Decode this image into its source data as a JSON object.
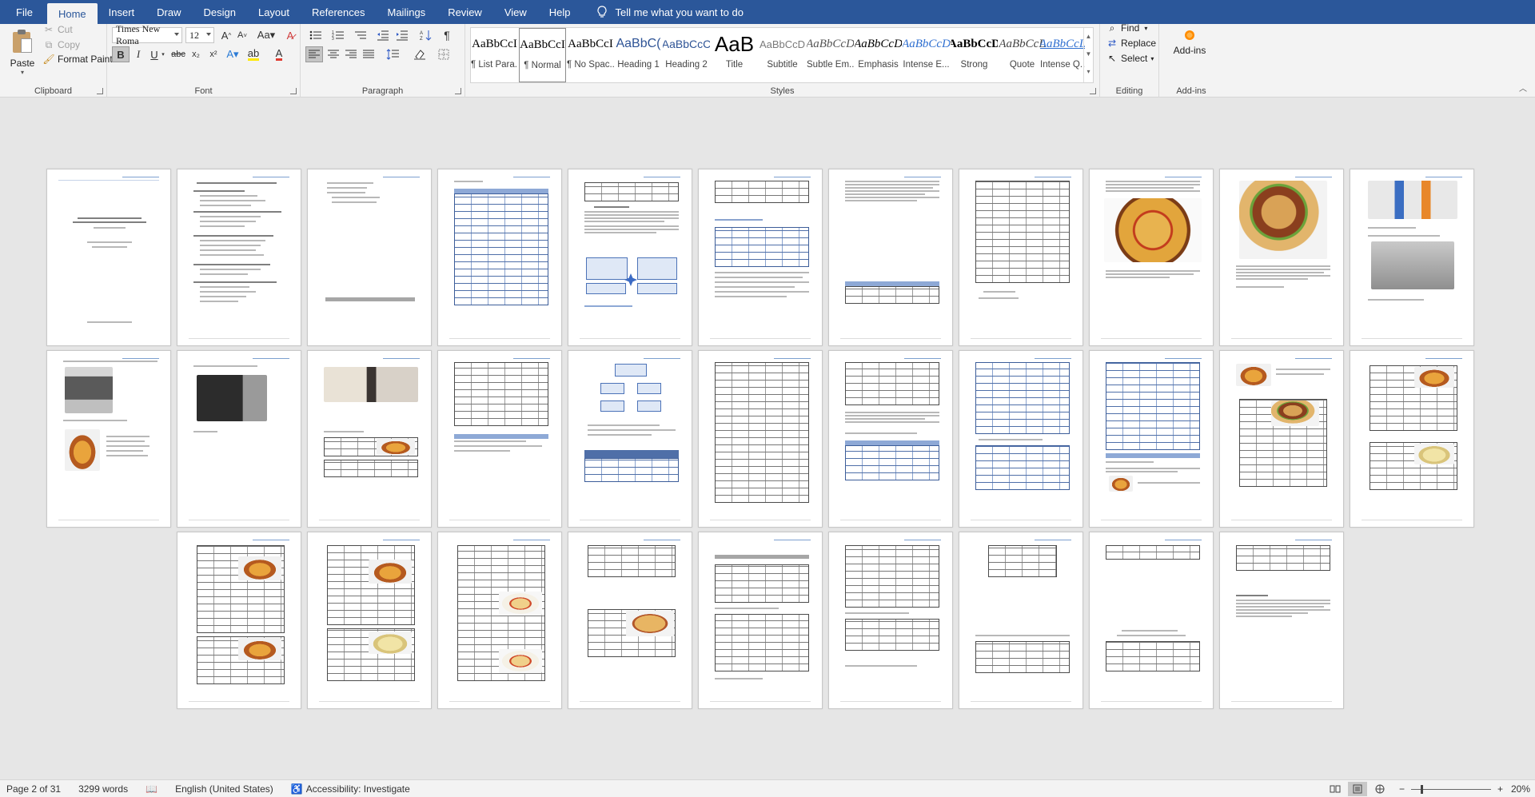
{
  "tabs": [
    "File",
    "Home",
    "Insert",
    "Draw",
    "Design",
    "Layout",
    "References",
    "Mailings",
    "Review",
    "View",
    "Help"
  ],
  "active_tab": "Home",
  "tell_me": "Tell me what you want to do",
  "clipboard": {
    "paste": "Paste",
    "cut": "Cut",
    "copy": "Copy",
    "format_painter": "Format Painter",
    "label": "Clipboard"
  },
  "font": {
    "name": "Times New Roma",
    "size": "12",
    "label": "Font",
    "buttons": [
      "B",
      "I",
      "U",
      "abc",
      "x₂",
      "x²"
    ]
  },
  "paragraph": {
    "label": "Paragraph"
  },
  "styles": {
    "label": "Styles",
    "items": [
      {
        "sample": "AaBbCcI",
        "name": "¶ List Para..."
      },
      {
        "sample": "AaBbCcI",
        "name": "¶ Normal"
      },
      {
        "sample": "AaBbCcI",
        "name": "¶ No Spac..."
      },
      {
        "sample": "AaBbC(",
        "name": "Heading 1"
      },
      {
        "sample": "AaBbCcC",
        "name": "Heading 2"
      },
      {
        "sample": "AaB",
        "name": "Title"
      },
      {
        "sample": "AaBbCcD",
        "name": "Subtitle"
      },
      {
        "sample": "AaBbCcD",
        "name": "Subtle Em..."
      },
      {
        "sample": "AaBbCcD",
        "name": "Emphasis"
      },
      {
        "sample": "AaBbCcD",
        "name": "Intense E..."
      },
      {
        "sample": "AaBbCcD",
        "name": "Strong"
      },
      {
        "sample": "AaBbCcL",
        "name": "Quote"
      },
      {
        "sample": "AaBbCcL",
        "name": "Intense Q..."
      }
    ],
    "selected_index": 1
  },
  "editing": {
    "find": "Find",
    "replace": "Replace",
    "select": "Select",
    "label": "Editing"
  },
  "addins": {
    "button": "Add-ins",
    "label": "Add-ins"
  },
  "status": {
    "page": "Page 2 of 31",
    "words": "3299 words",
    "language": "English (United States)",
    "accessibility": "Accessibility: Investigate",
    "zoom": "20%"
  },
  "document": {
    "total_pages": 31
  },
  "colors": {
    "ribbon_blue": "#2b579a",
    "ribbon_bg": "#f3f3f3",
    "doc_bg": "#e6e6e6",
    "font_color_red": "#e03a2f",
    "highlight_yellow": "#ffe800"
  }
}
